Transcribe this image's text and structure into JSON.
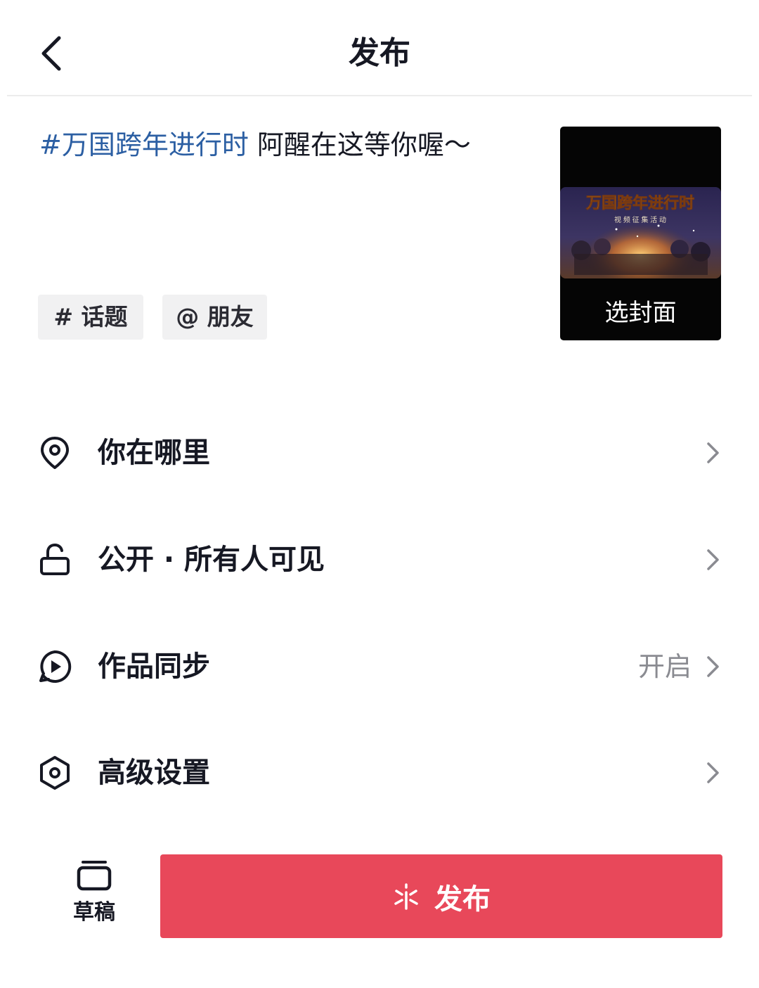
{
  "header": {
    "title": "发布",
    "back_icon": "chevron-left-icon"
  },
  "caption": {
    "hashtag": "#万国跨年进行时",
    "text": " 阿醒在这等你喔～"
  },
  "chips": {
    "topic": "# 话题",
    "friend": "@ 朋友"
  },
  "cover": {
    "art_title": "万国跨年进行时",
    "art_subtitle": "视 频 征 集 活 动",
    "label": "选封面"
  },
  "rows": [
    {
      "icon": "location-pin-icon",
      "label": "你在哪里",
      "value": ""
    },
    {
      "icon": "lock-open-icon",
      "label": "公开 · 所有人可见",
      "value": ""
    },
    {
      "icon": "sync-play-icon",
      "label": "作品同步",
      "value": "开启"
    },
    {
      "icon": "hexagon-settings-icon",
      "label": "高级设置",
      "value": ""
    }
  ],
  "bottom": {
    "draft_label": "草稿",
    "publish_label": "发布",
    "publish_icon": "sparkle-icon"
  },
  "colors": {
    "accent": "#e8485a",
    "hashtag": "#2c5fa3",
    "text": "#161823",
    "secondary": "#8a8b91"
  }
}
